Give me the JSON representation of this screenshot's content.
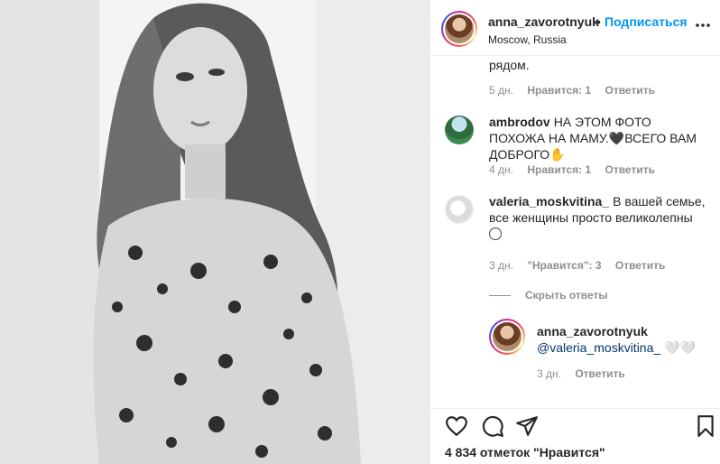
{
  "post": {
    "username": "anna_zavorotnyuk",
    "dot": "•",
    "follow_label": "Подписаться",
    "location": "Moscow, Russia",
    "more_icon": "more-horizontal-icon",
    "photo_description_icon": "photo"
  },
  "comments": {
    "truncated_line": "рядом.",
    "c1": {
      "time": "5 дн.",
      "likes": "Нравится: 1",
      "reply": "Ответить"
    },
    "c2": {
      "username": "ambrodov",
      "text": "НА ЭТОМ ФОТО ПОХОЖА НА МАМУ.🖤ВСЕГО ВАМ ДОБРОГО✋",
      "time": "4 дн.",
      "likes": "Нравится: 1",
      "reply": "Ответить"
    },
    "c3": {
      "username": "valeria_moskvitina_",
      "text": "В вашей семье, все женщины просто великолепны",
      "time": "3 дн.",
      "likes": "\"Нравится\": 3",
      "reply": "Ответить"
    },
    "hide_replies": "Скрыть ответы",
    "reply": {
      "username": "anna_zavorotnyuk",
      "mention": "@valeria_moskvitina_",
      "text_after": " 🤍🤍",
      "time": "3 дн.",
      "reply": "Ответить"
    }
  },
  "actions": {
    "likes_count": "4 834 отметок \"Нравится\""
  },
  "colors": {
    "accent": "#0095f6",
    "text": "#262626",
    "muted": "#8e8e8e",
    "mention": "#00376b"
  }
}
